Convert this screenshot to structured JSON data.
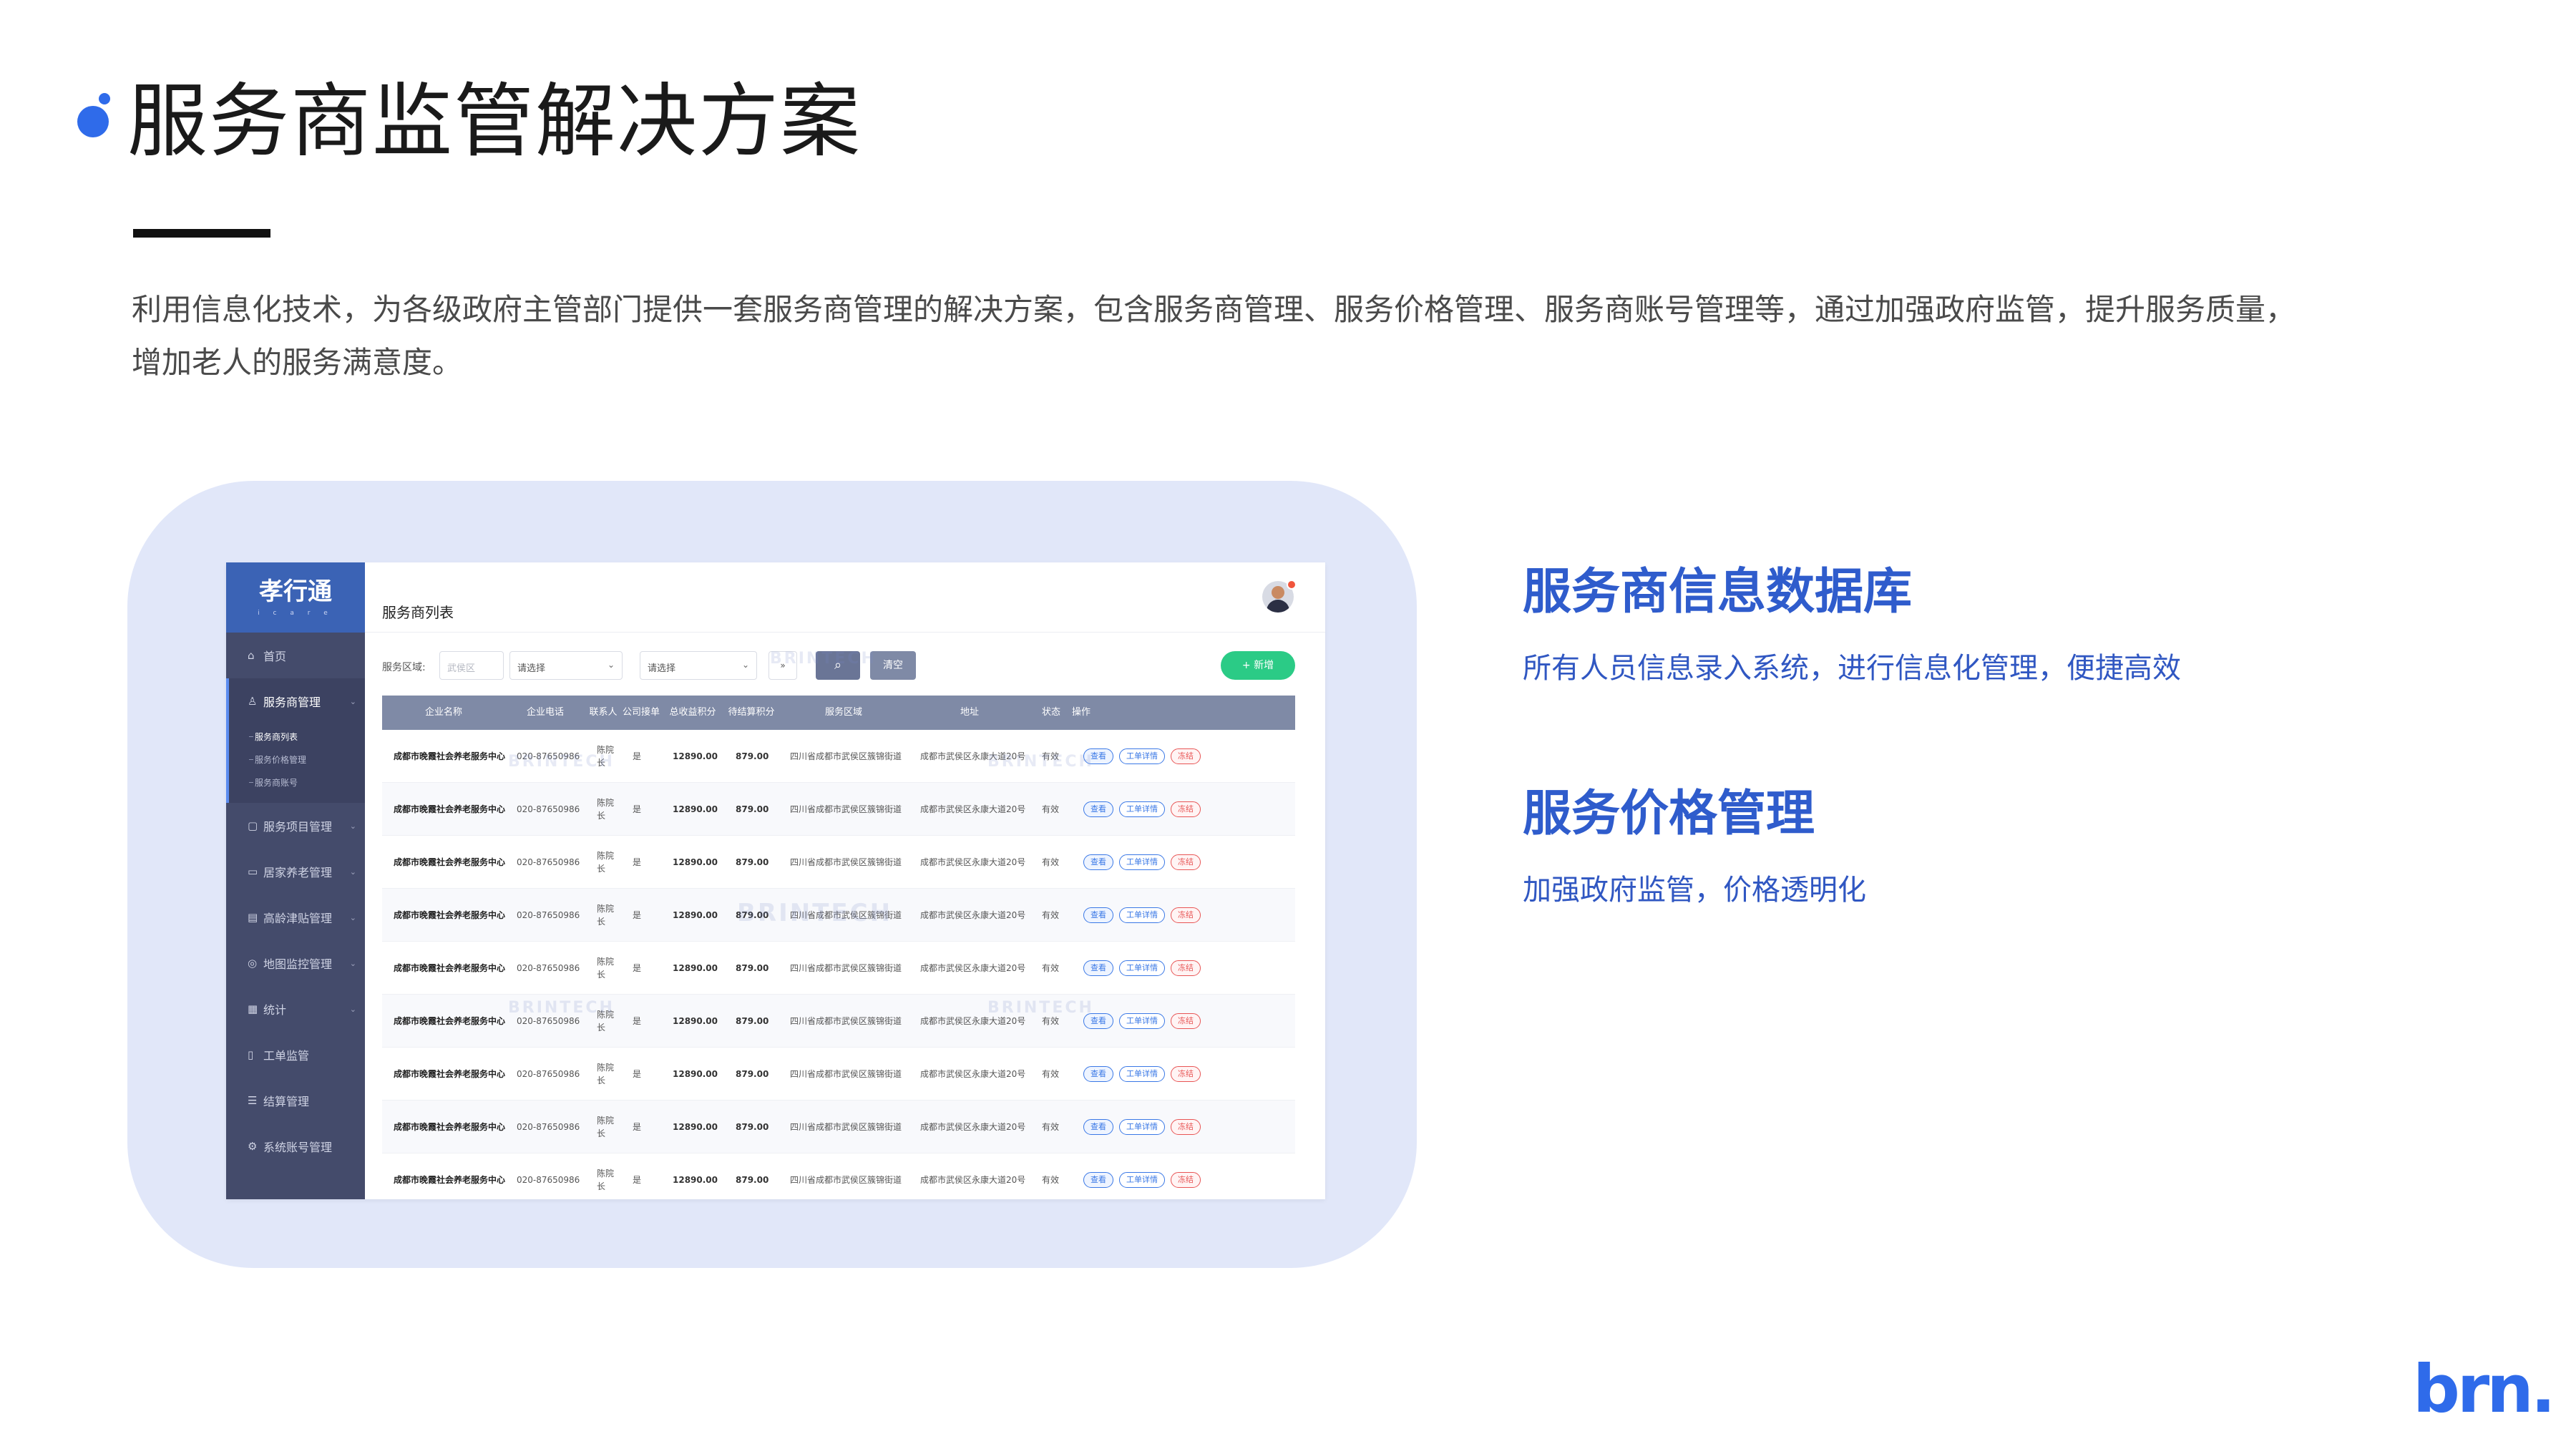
{
  "slide": {
    "title": "服务商监管解决方案",
    "intro": "利用信息化技术，为各级政府主管部门提供一套服务商管理的解决方案，包含服务商管理、服务价格管理、服务商账号管理等，通过加强政府监管，提升服务质量，增加老人的服务满意度。",
    "brand": "brn.",
    "accent_color": "#2f6bea"
  },
  "app": {
    "logo": "孝行通",
    "logo_sub": "i c a r e",
    "page_title": "服务商列表",
    "sidebar": {
      "items": [
        {
          "label": "首页",
          "icon": "home-icon",
          "glyph": "⌂"
        },
        {
          "label": "服务商管理",
          "icon": "user-icon",
          "glyph": "♙",
          "expanded": true
        },
        {
          "label": "服务项目管理",
          "icon": "folder-icon",
          "glyph": "▢"
        },
        {
          "label": "居家养老管理",
          "icon": "home-care-icon",
          "glyph": "▭"
        },
        {
          "label": "高龄津贴管理",
          "icon": "card-icon",
          "glyph": "▤"
        },
        {
          "label": "地图监控管理",
          "icon": "map-pin-icon",
          "glyph": "◎"
        },
        {
          "label": "统计",
          "icon": "bar-chart-icon",
          "glyph": "▦"
        },
        {
          "label": "工单监管",
          "icon": "document-icon",
          "glyph": "▯"
        },
        {
          "label": "结算管理",
          "icon": "list-icon",
          "glyph": "☰"
        },
        {
          "label": "系统账号管理",
          "icon": "gear-icon",
          "glyph": "⚙"
        }
      ],
      "sub_items": [
        {
          "label": "服务商列表",
          "active": true
        },
        {
          "label": "服务价格管理",
          "active": false
        },
        {
          "label": "服务商账号",
          "active": false
        }
      ]
    },
    "filter": {
      "label": "服务区域:",
      "select1_placeholder": "武侯区",
      "select2_value": "请选择",
      "select3_value": "请选择",
      "search_icon": "search-icon",
      "clear_label": "清空",
      "add_label": "+ 新增"
    },
    "table": {
      "headers": [
        "企业名称",
        "企业电话",
        "联系人",
        "公司接单",
        "总收益积分",
        "待结算积分",
        "服务区域",
        "地址",
        "状态",
        "操作"
      ],
      "actions": [
        "查看",
        "工单详情",
        "冻结"
      ],
      "row_template": {
        "name": "成都市晚霞社会养老服务中心",
        "phone": "020-87650986",
        "contact": "陈院长",
        "accept": "是",
        "total": "12890.00",
        "pending": "879.00",
        "region": "四川省成都市武侯区簇锦街道",
        "address": "成都市武侯区永康大道20号",
        "status": "有效"
      },
      "row_count": 9
    },
    "watermark": "BRINTECH"
  },
  "features": [
    {
      "title": "服务商信息数据库",
      "desc": "所有人员信息录入系统，进行信息化管理，便捷高效"
    },
    {
      "title": "服务价格管理",
      "desc": "加强政府监管，价格透明化"
    }
  ]
}
